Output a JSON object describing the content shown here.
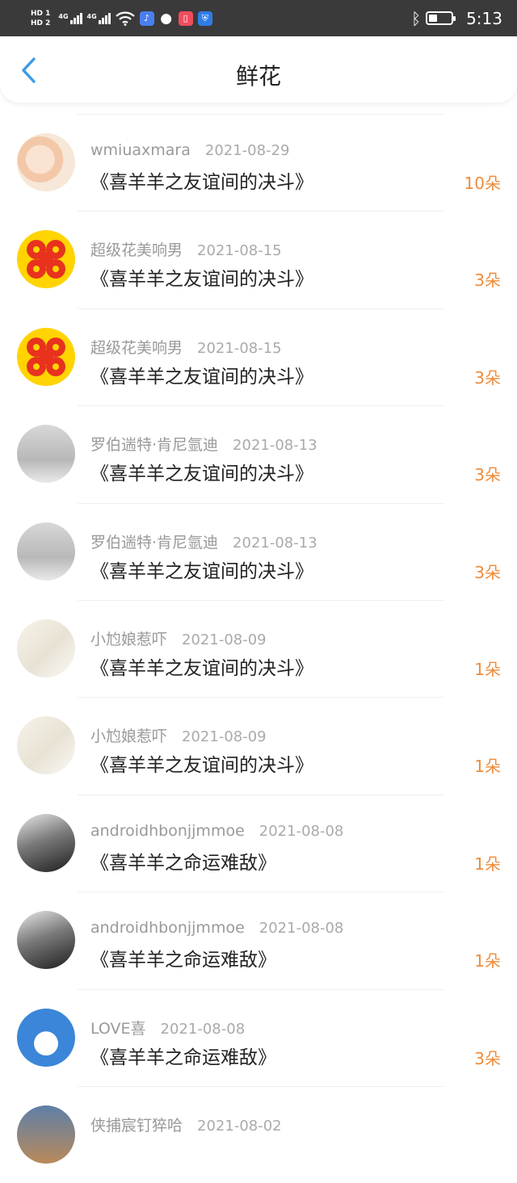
{
  "status_bar": {
    "sim1": "HD 1",
    "sim2": "HD 2",
    "net1": "4G",
    "net2": "4G",
    "time": "5:13",
    "icons": [
      "signal-icon",
      "wifi-icon",
      "music-app-icon",
      "chat-bubble-icon",
      "book-app-icon",
      "shield-app-icon",
      "bluetooth-icon",
      "battery-icon"
    ]
  },
  "header": {
    "title": "鲜花",
    "back_icon": "chevron-left-icon"
  },
  "colors": {
    "accent": "#3b9ae8",
    "count": "#ef8b3a",
    "status_bar": "#3a3a3a"
  },
  "items": [
    {
      "user": "wmiuaxmara",
      "date": "2021-08-29",
      "book": "《喜羊羊之友谊间的决斗》",
      "count": "10朵",
      "avatar": "girl-illustration"
    },
    {
      "user": "超级花美响男",
      "date": "2021-08-15",
      "book": "《喜羊羊之友谊间的决斗》",
      "count": "3朵",
      "avatar": "red-flower-pattern"
    },
    {
      "user": "超级花美响男",
      "date": "2021-08-15",
      "book": "《喜羊羊之友谊间的决斗》",
      "count": "3朵",
      "avatar": "red-flower-pattern"
    },
    {
      "user": "罗伯遄特·肯尼氩迪",
      "date": "2021-08-13",
      "book": "《喜羊羊之友谊间的决斗》",
      "count": "3朵",
      "avatar": "man-selfie"
    },
    {
      "user": "罗伯遄特·肯尼氩迪",
      "date": "2021-08-13",
      "book": "《喜羊羊之友谊间的决斗》",
      "count": "3朵",
      "avatar": "man-selfie"
    },
    {
      "user": "小尥娘惹吓",
      "date": "2021-08-09",
      "book": "《喜羊羊之友谊间的决斗》",
      "count": "1朵",
      "avatar": "girl-reading"
    },
    {
      "user": "小尥娘惹吓",
      "date": "2021-08-09",
      "book": "《喜羊羊之友谊间的决斗》",
      "count": "1朵",
      "avatar": "girl-reading"
    },
    {
      "user": "androidhbonjjmmoe",
      "date": "2021-08-08",
      "book": "《喜羊羊之命运难敌》",
      "count": "1朵",
      "avatar": "bw-portrait"
    },
    {
      "user": "androidhbonjjmmoe",
      "date": "2021-08-08",
      "book": "《喜羊羊之命运难敌》",
      "count": "1朵",
      "avatar": "bw-portrait"
    },
    {
      "user": "LOVE喜",
      "date": "2021-08-08",
      "book": "《喜羊羊之命运难敌》",
      "count": "3朵",
      "avatar": "cartoon-sheep"
    },
    {
      "user": "侠捕宸钉猝哈",
      "date": "2021-08-02",
      "book": "",
      "count": "",
      "avatar": "scenic"
    }
  ]
}
